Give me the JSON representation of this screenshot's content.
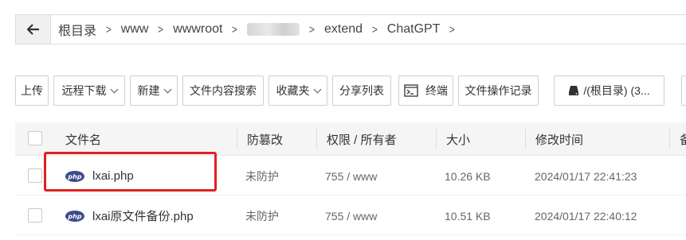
{
  "breadcrumb": {
    "items": [
      "根目录",
      "www",
      "wwwroot",
      "",
      "extend",
      "ChatGPT"
    ],
    "separator": ">"
  },
  "toolbar": {
    "upload": "上传",
    "remote_download": "远程下载",
    "new": "新建",
    "search_content": "文件内容搜索",
    "favorites": "收藏夹",
    "share_list": "分享列表",
    "terminal": "终端",
    "op_log": "文件操作记录",
    "disk": "/(根目录) (3..."
  },
  "table": {
    "headers": {
      "name": "文件名",
      "tamper": "防篡改",
      "perm": "权限 / 所有者",
      "size": "大小",
      "mtime": "修改时间",
      "extra": "备"
    },
    "rows": [
      {
        "name": "lxai.php",
        "tamper": "未防护",
        "perm": "755 / www",
        "size": "10.26 KB",
        "mtime": "2024/01/17 22:41:23"
      },
      {
        "name": "lxai原文件备份.php",
        "tamper": "未防护",
        "perm": "755 / www",
        "size": "10.51 KB",
        "mtime": "2024/01/17 22:40:12"
      }
    ]
  },
  "colors": {
    "highlight": "#e02020",
    "php_icon": "#3d4b8c"
  }
}
